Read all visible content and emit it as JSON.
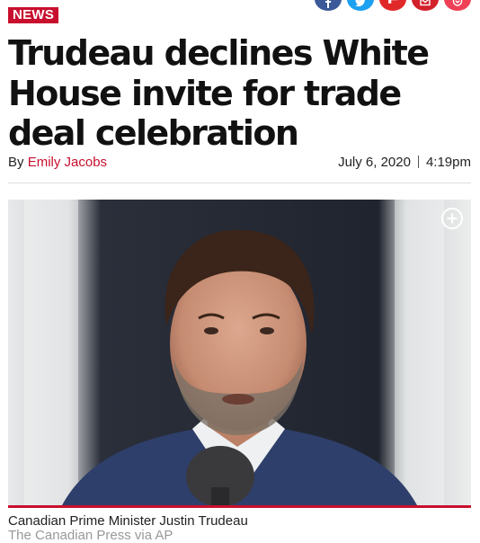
{
  "share": {
    "buttons": [
      {
        "name": "facebook",
        "icon": "facebook-icon",
        "color": "#3b5998"
      },
      {
        "name": "twitter",
        "icon": "twitter-icon",
        "color": "#1da1f2"
      },
      {
        "name": "flipboard",
        "icon": "flipboard-icon",
        "color": "#e12828"
      },
      {
        "name": "email",
        "icon": "email-icon",
        "color": "#d3212c"
      },
      {
        "name": "pocket",
        "icon": "pocket-icon",
        "color": "#ef4056"
      }
    ]
  },
  "article": {
    "section": "NEWS",
    "headline": "Trudeau declines White House invite for trade deal celebration",
    "byline_prefix": "By",
    "author": "Emily Jacobs",
    "date": "July 6, 2020",
    "time": "4:19pm"
  },
  "photo": {
    "expand_icon": "expand-icon",
    "caption": "Canadian Prime Minister Justin Trudeau",
    "credit": "The Canadian Press via AP"
  },
  "colors": {
    "accent": "#c8102e",
    "credit_gray": "#999999"
  }
}
